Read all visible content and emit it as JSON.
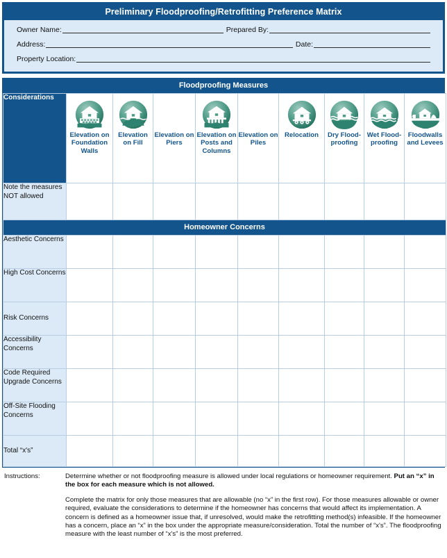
{
  "header": {
    "title": "Preliminary Floodproofing/Retrofitting Preference Matrix",
    "fields": [
      {
        "label": "Owner Name:",
        "value": ""
      },
      {
        "label": "Prepared By:",
        "value": ""
      },
      {
        "label": "Address:",
        "value": ""
      },
      {
        "label": "Date:",
        "value": ""
      },
      {
        "label": "Property Location:",
        "value": ""
      }
    ]
  },
  "matrix": {
    "measures_band": "Floodproofing Measures",
    "concerns_band": "Homeowner Concerns",
    "considerations_label": "Considerations",
    "columns": [
      {
        "label": "Elevation on Foundation Walls",
        "icon": "house-on-foundation-walls-icon",
        "has_icon": true
      },
      {
        "label": "Elevation on Fill",
        "icon": "house-on-fill-icon",
        "has_icon": true
      },
      {
        "label": "Elevation on Piers",
        "icon": "none",
        "has_icon": false
      },
      {
        "label": "Elevation on Posts and Columns",
        "icon": "house-on-posts-icon",
        "has_icon": true
      },
      {
        "label": "Elevation on Piles",
        "icon": "none",
        "has_icon": false
      },
      {
        "label": "Relocation",
        "icon": "house-on-wheels-icon",
        "has_icon": true
      },
      {
        "label": "Dry Flood-proofing",
        "icon": "house-dry-floodproofing-icon",
        "has_icon": true
      },
      {
        "label": "Wet Flood-proofing",
        "icon": "house-wet-floodproofing-icon",
        "has_icon": true
      },
      {
        "label": "Floodwalls and Levees",
        "icon": "house-floodwall-levee-icon",
        "has_icon": true
      }
    ],
    "note_row": {
      "label": "Note the measures NOT allowed"
    },
    "concern_rows": [
      {
        "label": "Aesthetic Concerns"
      },
      {
        "label": "High Cost Concerns"
      },
      {
        "label": "Risk Concerns"
      },
      {
        "label": "Accessibility Concerns"
      },
      {
        "label": "Code Required Upgrade Concerns"
      },
      {
        "label": "Off-Site Flooding Concerns"
      }
    ],
    "total_row": {
      "label": "Total “x's”"
    }
  },
  "instructions": {
    "label": "Instructions:",
    "paragraph1_normal": "Determine whether or not floodproofing measure is allowed under local regulations or homeowner requirement. ",
    "paragraph1_bold": "Put an “x” in the box for each measure which is not allowed.",
    "paragraph2": "Complete the matrix for only those measures that are allowable (no “x” in the first row). For those measures allowable or owner required, evaluate the considerations to determine if the homeowner has concerns that would affect its implementation. A concern is defined as a homeowner issue that, if unresolved, would make the retrofitting method(s) infeasible. If the homeowner has a concern, place an “x” in the box under the appropriate measure/consideration. Total the number of “x's”. The floodproofing measure with the least number of “x's” is the most preferred."
  },
  "colors": {
    "brand_blue": "#13548C",
    "pale_blue": "#DCEAF7",
    "grid_line": "#B6CDE4",
    "icon_green": "#2E8370"
  }
}
